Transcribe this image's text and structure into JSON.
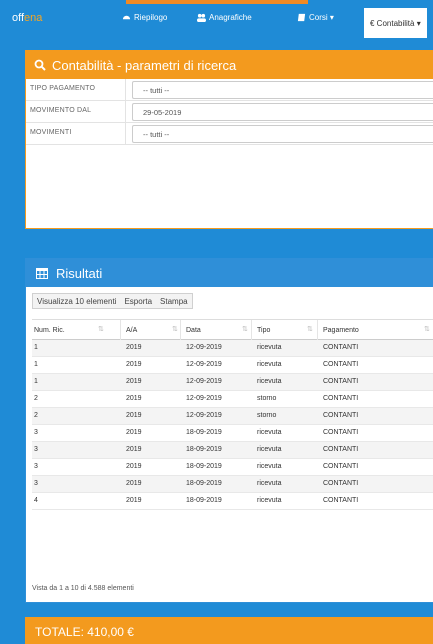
{
  "nav": {
    "logo_a": "off",
    "logo_b": "ena",
    "items": [
      {
        "label": "Riepilogo",
        "icon": "dashboard-icon"
      },
      {
        "label": "Anagrafiche",
        "icon": "users-icon"
      },
      {
        "label": "Corsi ▾",
        "icon": "book-icon"
      },
      {
        "label": "€  Contabilità ▾",
        "icon": "euro-icon"
      }
    ]
  },
  "search_panel": {
    "title": "Contabilità - parametri di ricerca",
    "fields": [
      {
        "label": "TIPO PAGAMENTO",
        "value": "-- tutti --"
      },
      {
        "label": "MOVIMENTO DAL",
        "value": "29-05-2019"
      },
      {
        "label": "MOVIMENTI",
        "value": "-- tutti --"
      }
    ]
  },
  "results_panel": {
    "title": "Risultati",
    "toolbar": [
      "Visualizza 10 elementi",
      "Esporta",
      "Stampa"
    ],
    "columns": [
      "Num. Ric.",
      "A/A",
      "Data",
      "Tipo",
      "Pagamento"
    ],
    "rows": [
      [
        "1",
        "2019",
        "12-09-2019",
        "ricevuta",
        "CONTANTI"
      ],
      [
        "1",
        "2019",
        "12-09-2019",
        "ricevuta",
        "CONTANTI"
      ],
      [
        "1",
        "2019",
        "12-09-2019",
        "ricevuta",
        "CONTANTI"
      ],
      [
        "2",
        "2019",
        "12-09-2019",
        "storno",
        "CONTANTI"
      ],
      [
        "2",
        "2019",
        "12-09-2019",
        "storno",
        "CONTANTI"
      ],
      [
        "3",
        "2019",
        "18-09-2019",
        "ricevuta",
        "CONTANTI"
      ],
      [
        "3",
        "2019",
        "18-09-2019",
        "ricevuta",
        "CONTANTI"
      ],
      [
        "3",
        "2019",
        "18-09-2019",
        "ricevuta",
        "CONTANTI"
      ],
      [
        "3",
        "2019",
        "18-09-2019",
        "ricevuta",
        "CONTANTI"
      ],
      [
        "4",
        "2019",
        "18-09-2019",
        "ricevuta",
        "CONTANTI"
      ]
    ],
    "info": "Vista da 1 a 10 di 4.588 elementi"
  },
  "total": {
    "label": "TOTALE: 410,00 €"
  },
  "colors": {
    "primary": "#1f8bd6",
    "accent": "#f39a1e"
  }
}
